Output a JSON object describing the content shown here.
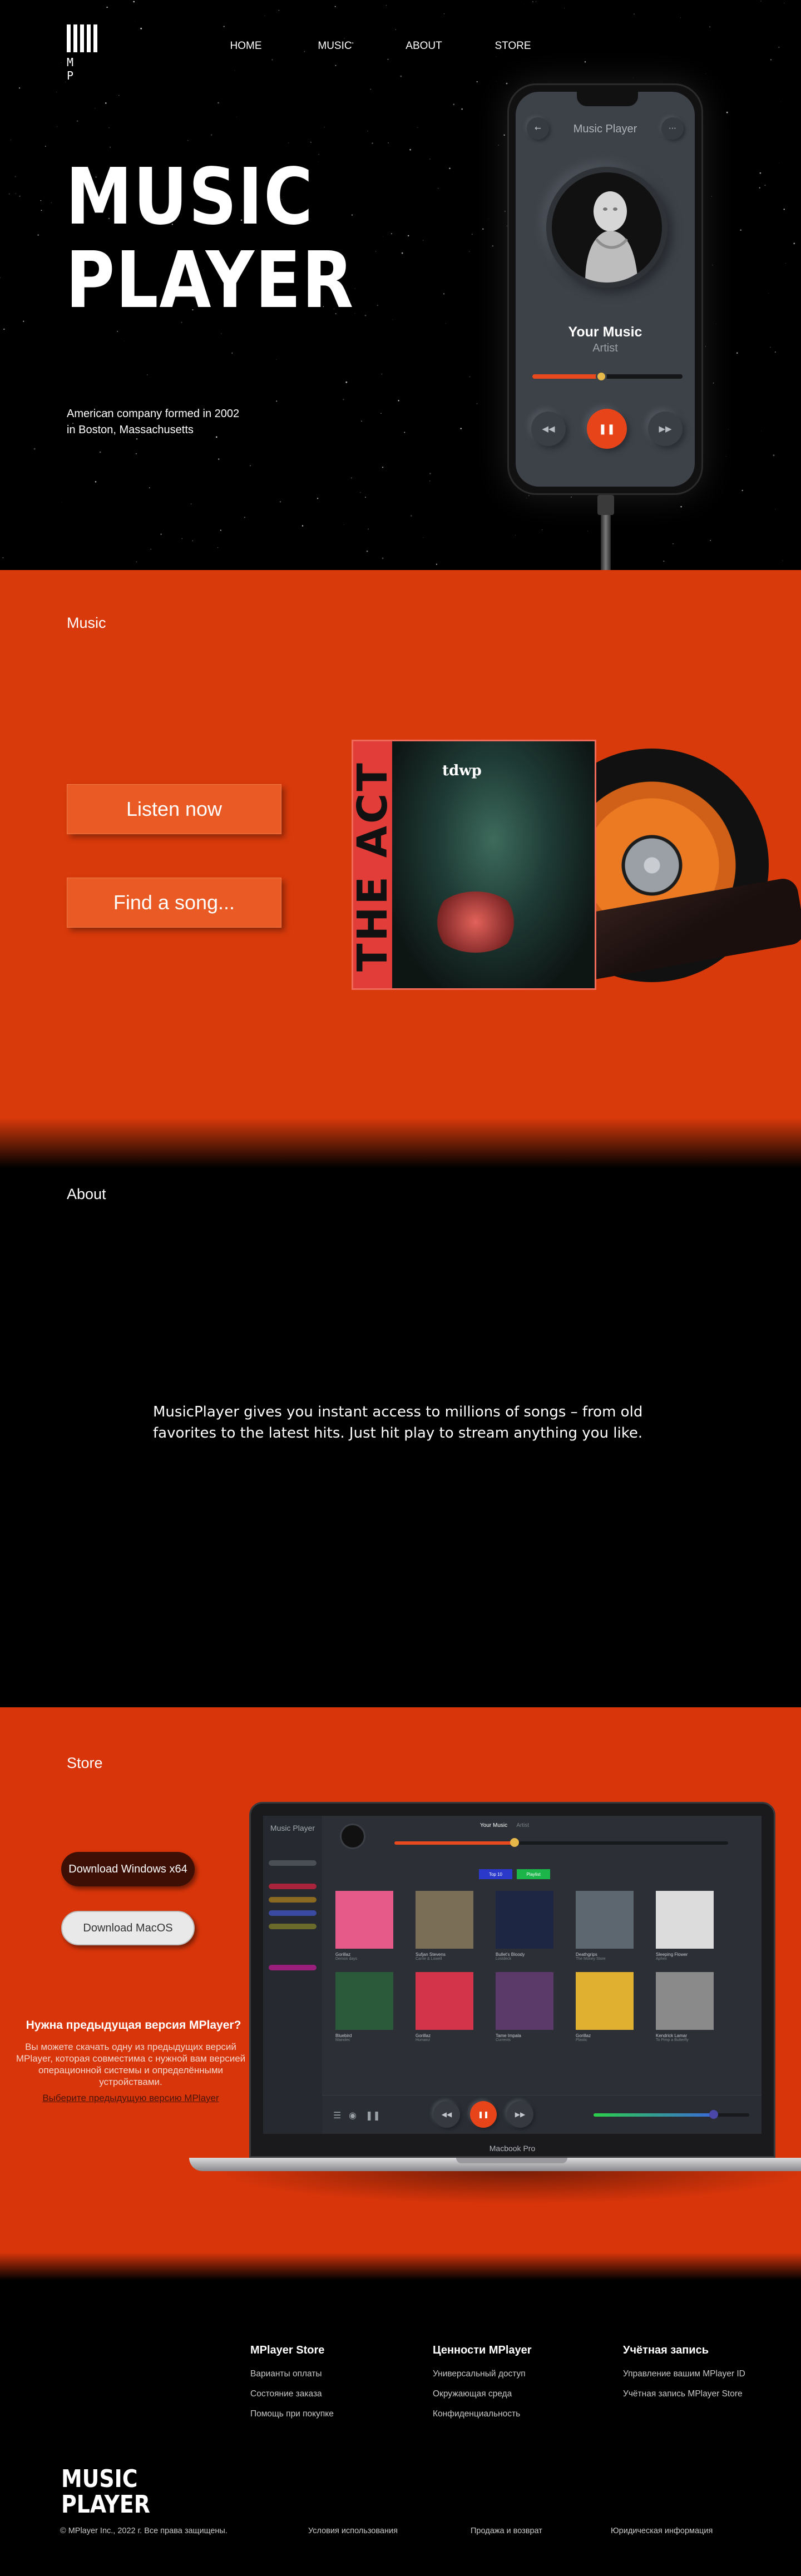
{
  "header": {
    "logo_text": "M P",
    "nav": [
      "HOME",
      "MUSIC",
      "ABOUT",
      "STORE"
    ]
  },
  "hero": {
    "title_line1": "MUSIC",
    "title_line2": "PLAYER",
    "subtitle": "American company formed in 2002 in Boston, Massachusetts"
  },
  "phone": {
    "title": "Music Player",
    "song": "Your Music",
    "artist": "Artist",
    "progress": 0.46,
    "icons": {
      "back": "arrow-left-icon",
      "menu": "menu-icon",
      "prev": "rewind-icon",
      "play": "pause-icon",
      "next": "forward-icon"
    }
  },
  "music": {
    "label": "Music",
    "listen_button": "Listen now",
    "find_button": "Find a song...",
    "album": {
      "title": "THE ACT",
      "logo": "tdwp"
    }
  },
  "about": {
    "label": "About",
    "text": "MusicPlayer gives you instant access to millions of songs – from old favorites to the latest hits. Just hit play to stream anything you like."
  },
  "store": {
    "label": "Store",
    "download_windows": "Download Windows x64",
    "download_mac": "Download MacOS",
    "prev_title": "Нужна предыдущая версия MPlayer?",
    "prev_text": "Вы можете скачать одну из предыдущих версий MPlayer, которая совместима с нужной вам версией операционной системы и определёнными устройствами.",
    "prev_link": "Выберите предыдущую версию MPlayer",
    "laptop": {
      "brand": "Music Player",
      "tabs": [
        "Your Music",
        "Artist"
      ],
      "chips": [
        "Top 10",
        "Playlist"
      ],
      "progress": 0.36,
      "volume": 0.77,
      "label": "Macbook Pro",
      "albums": [
        {
          "title": "Gorillaz",
          "artist": "Demon days",
          "color": "#e65a8a"
        },
        {
          "title": "Sufjan Stevens",
          "artist": "Carrie & Lowell",
          "color": "#7b6e56"
        },
        {
          "title": "Bullet's Bloody",
          "artist": "Lostdeck",
          "color": "#1d2744"
        },
        {
          "title": "Deathgrips",
          "artist": "The Money Store",
          "color": "#5c6770"
        },
        {
          "title": "Sleeping Flower",
          "artist": "Aphex",
          "color": "#dcdcdc"
        },
        {
          "title": "Bluebird",
          "artist": "Maindec",
          "color": "#2a5a3a"
        },
        {
          "title": "Gorillaz",
          "artist": "Humanz",
          "color": "#d4344a"
        },
        {
          "title": "Tame Impala",
          "artist": "Currents",
          "color": "#5b3a6a"
        },
        {
          "title": "Gorillaz",
          "artist": "Plastic",
          "color": "#e0b030"
        },
        {
          "title": "Kendrick Lamar",
          "artist": "To Pimp a Butterfly",
          "color": "#8a8a8a"
        }
      ]
    }
  },
  "footer": {
    "columns": [
      {
        "title": "MPlayer Store",
        "links": [
          "Варианты оплаты",
          "Состояние заказа",
          "Помощь при покупке"
        ]
      },
      {
        "title": "Ценности MPlayer",
        "links": [
          "Универсальный доступ",
          "Окружающая среда",
          "Конфиденциальность"
        ]
      },
      {
        "title": "Учётная запись",
        "links": [
          "Управление вашим MPlayer ID",
          "Учётная запись MPlayer Store"
        ]
      }
    ],
    "logo_line1": "MUSIC",
    "logo_line2": "PLAYER",
    "copyright": "© MPlayer Inc., 2022 г. Все права защищены.",
    "bottom_links": [
      "Условия использования",
      "Продажа и возврат",
      "Юридическая информация"
    ]
  }
}
